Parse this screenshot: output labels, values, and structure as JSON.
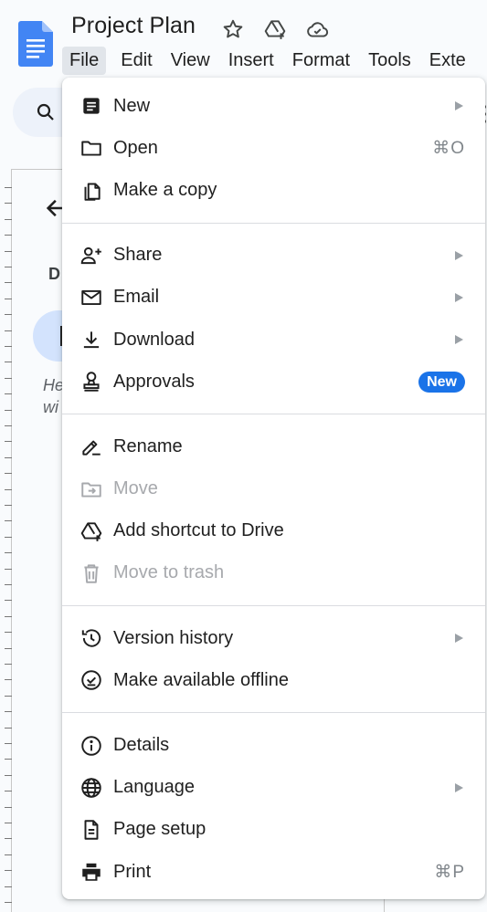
{
  "header": {
    "title": "Project Plan",
    "icons": [
      "star-icon",
      "move-to-drive-icon",
      "cloud-saved-icon"
    ]
  },
  "menubar": {
    "items": [
      "File",
      "Edit",
      "View",
      "Insert",
      "Format",
      "Tools",
      "Exte"
    ],
    "active": "File"
  },
  "outline": {
    "heading_initial": "D",
    "hint_line1": "He",
    "hint_line2": "wi"
  },
  "file_menu": {
    "groups": [
      [
        {
          "label": "New",
          "icon": "new-document-icon",
          "submenu": true
        },
        {
          "label": "Open",
          "icon": "folder-icon",
          "shortcut": "⌘O"
        },
        {
          "label": "Make a copy",
          "icon": "copy-icon"
        }
      ],
      [
        {
          "label": "Share",
          "icon": "share-person-icon",
          "submenu": true
        },
        {
          "label": "Email",
          "icon": "mail-icon",
          "submenu": true
        },
        {
          "label": "Download",
          "icon": "download-icon",
          "submenu": true
        },
        {
          "label": "Approvals",
          "icon": "approval-stamp-icon",
          "badge": "New"
        }
      ],
      [
        {
          "label": "Rename",
          "icon": "rename-pencil-icon"
        },
        {
          "label": "Move",
          "icon": "move-folder-icon",
          "disabled": true
        },
        {
          "label": "Add shortcut to Drive",
          "icon": "drive-shortcut-icon"
        },
        {
          "label": "Move to trash",
          "icon": "trash-icon",
          "disabled": true
        }
      ],
      [
        {
          "label": "Version history",
          "icon": "history-icon",
          "submenu": true
        },
        {
          "label": "Make available offline",
          "icon": "offline-check-icon"
        }
      ],
      [
        {
          "label": "Details",
          "icon": "info-icon"
        },
        {
          "label": "Language",
          "icon": "globe-icon",
          "submenu": true
        },
        {
          "label": "Page setup",
          "icon": "page-setup-icon"
        },
        {
          "label": "Print",
          "icon": "printer-icon",
          "shortcut": "⌘P"
        }
      ]
    ]
  },
  "colors": {
    "accent": "#1a73e8",
    "docs_blue": "#4285f4",
    "disabled_text": "#a7a9ad"
  }
}
